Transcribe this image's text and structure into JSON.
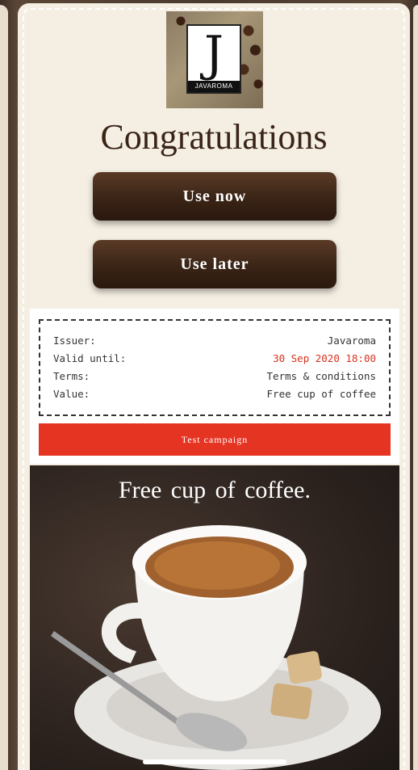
{
  "logo": {
    "letter": "J",
    "word": "JAVAROMA"
  },
  "header": {
    "title": "Congratulations"
  },
  "actions": {
    "use_now_label": "Use now",
    "use_later_label": "Use later"
  },
  "coupon": {
    "rows": [
      {
        "label": "Issuer:",
        "value": "Javaroma"
      },
      {
        "label": "Valid until:",
        "value": "30 Sep 2020 18:00"
      },
      {
        "label": "Terms:",
        "value": "Terms & conditions"
      },
      {
        "label": "Value:",
        "value": "Free cup of coffee"
      }
    ]
  },
  "campaign": {
    "label": "Test campaign"
  },
  "promo": {
    "caption": "Free cup of coffee."
  },
  "colors": {
    "background": "#f5efe3",
    "button": "#3a2416",
    "accent_red": "#e63423",
    "valid_until_text": "#d8321f"
  }
}
